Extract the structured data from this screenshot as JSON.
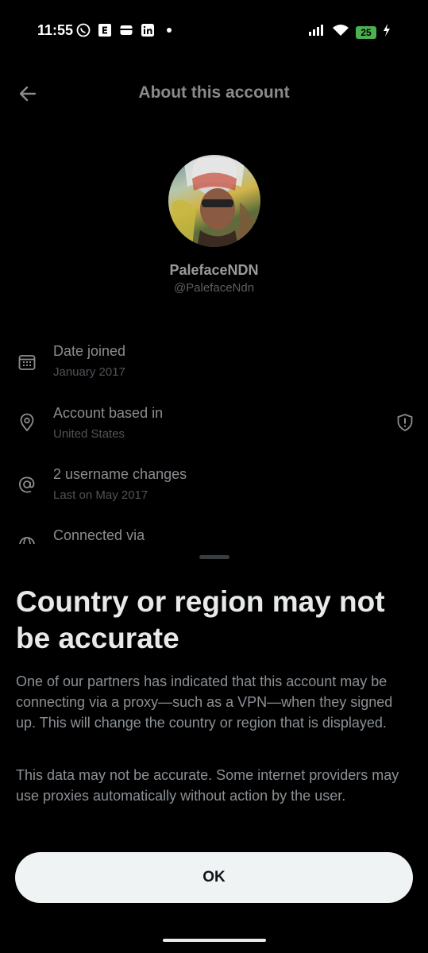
{
  "status_bar": {
    "time": "11:55",
    "battery": "25",
    "left_icons": [
      "whatsapp-icon",
      "e-app-icon",
      "wallet-icon",
      "linkedin-icon",
      "dot-icon"
    ],
    "right_icons": [
      "signal-icon",
      "wifi-icon",
      "battery-icon",
      "charging-icon"
    ]
  },
  "header": {
    "title": "About this account"
  },
  "profile": {
    "display_name": "PalefaceNDN",
    "handle": "@PalefaceNdn"
  },
  "info_rows": [
    {
      "title": "Date joined",
      "subtitle": "January 2017",
      "icon": "calendar-icon"
    },
    {
      "title": "Account based in",
      "subtitle": "United States",
      "icon": "location-pin-icon",
      "side_icon": "shield-alert-icon"
    },
    {
      "title": "2 username changes",
      "subtitle": "Last on May 2017",
      "icon": "at-sign-icon"
    },
    {
      "title": "Connected via",
      "icon": "globe-icon"
    }
  ],
  "sheet": {
    "title": "Country or region may not be accurate",
    "paragraph_1": "One of our partners has indicated that this account may be connecting via a proxy—such as a VPN—when they signed up. This will change the country or region that is displayed.",
    "paragraph_2": "This data may not be accurate. Some internet providers may use proxies automatically without action by the user.",
    "ok_label": "OK"
  },
  "colors": {
    "background": "#000000",
    "battery": "#4caf50",
    "button_bg": "#eff3f4"
  }
}
